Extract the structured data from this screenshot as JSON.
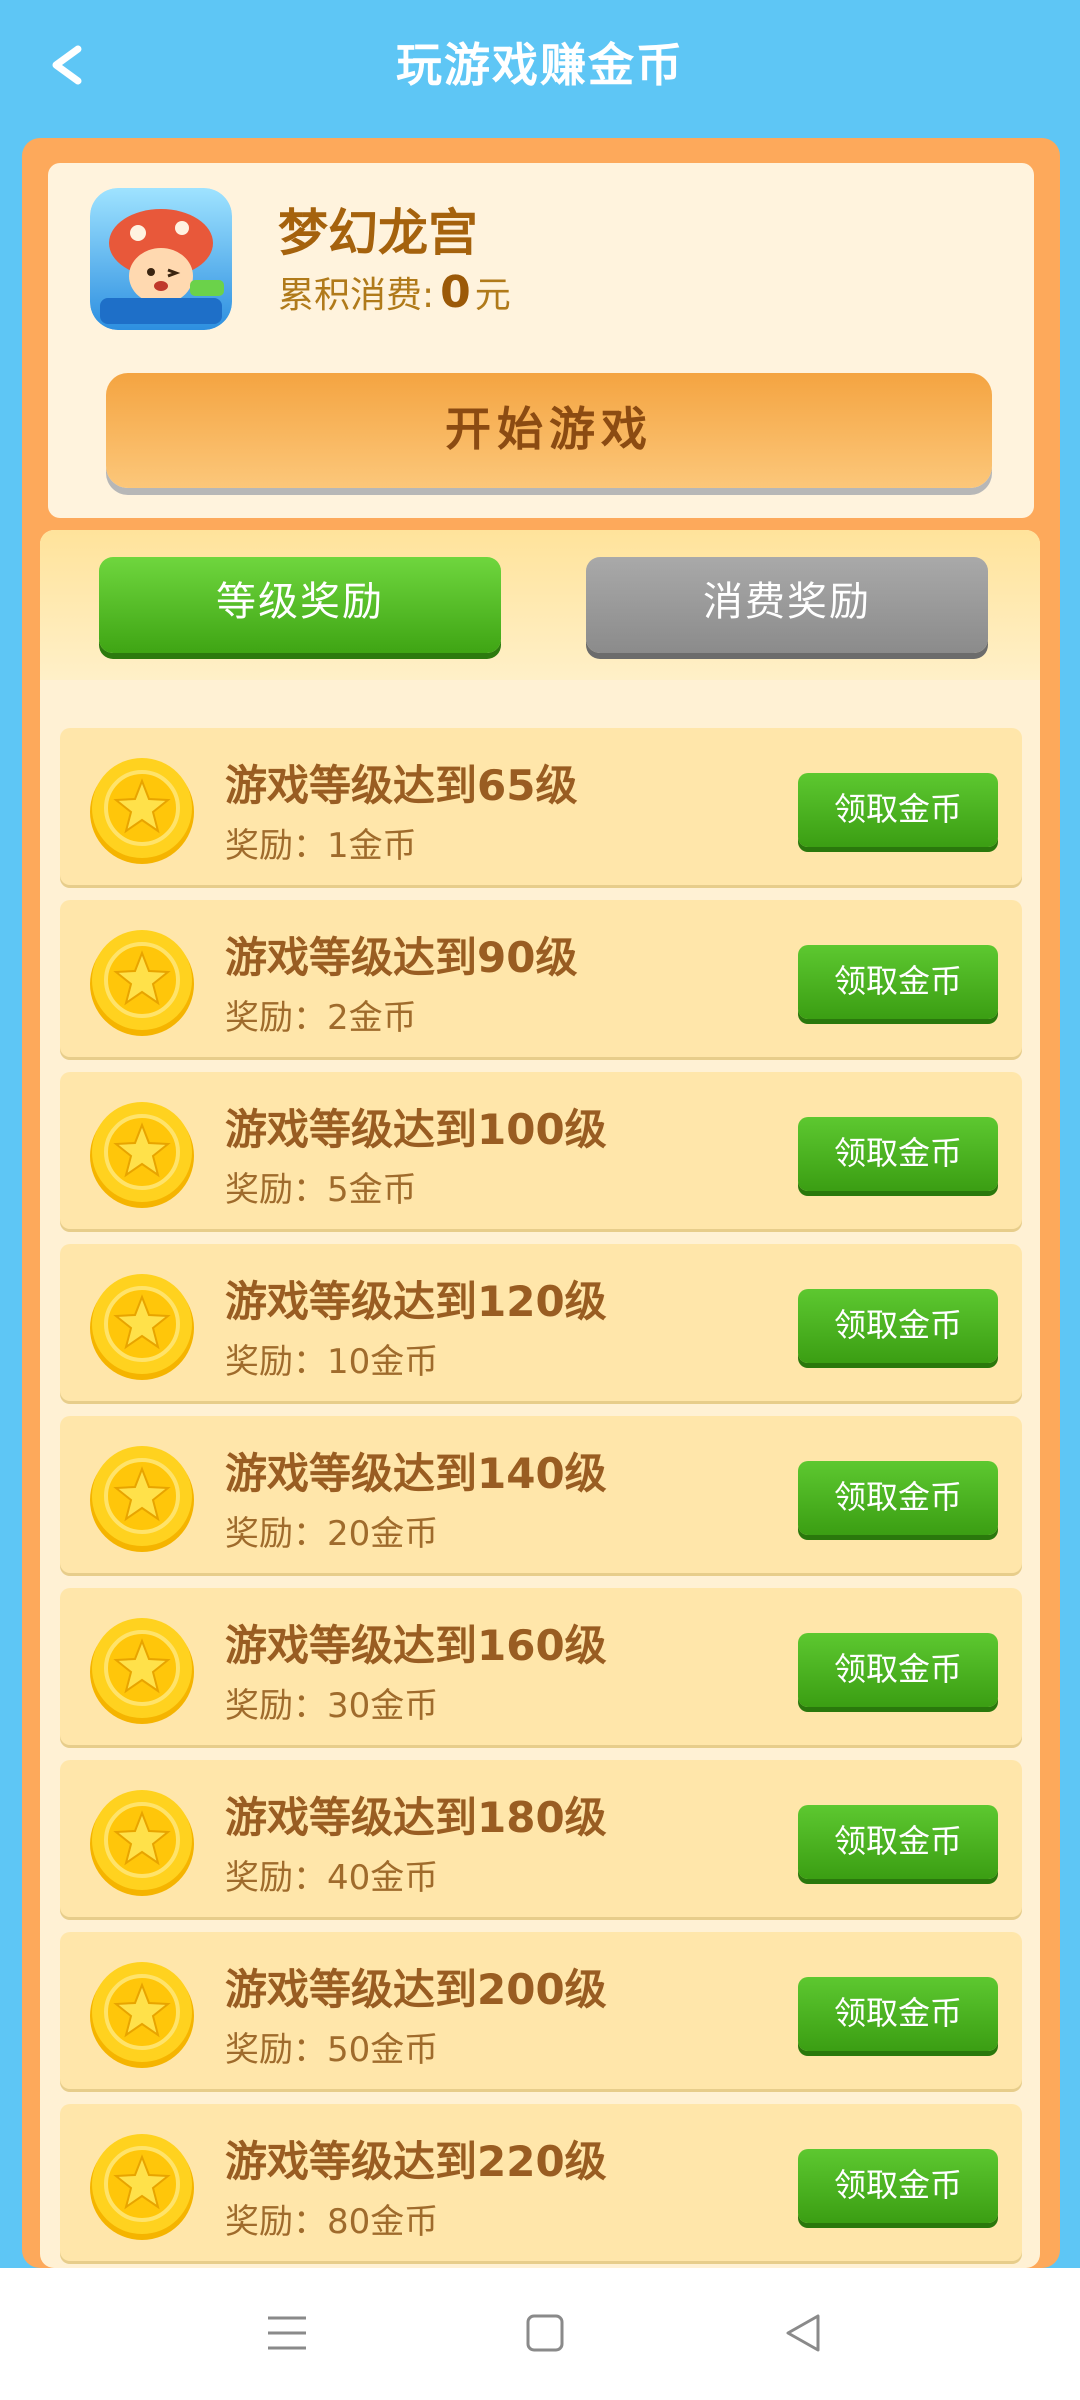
{
  "header": {
    "title": "玩游戏赚金币",
    "back_icon": "chevron-left-icon"
  },
  "game": {
    "name": "梦幻龙宫",
    "spend_label": "累积消费:",
    "spend_amount": "0",
    "spend_unit": "元",
    "start_label": "开始游戏"
  },
  "tabs": [
    {
      "label": "等级奖励",
      "active": true
    },
    {
      "label": "消费奖励",
      "active": false
    }
  ],
  "rewards": [
    {
      "title": "游戏等级达到65级",
      "reward": "奖励：1金币",
      "button": "领取金币"
    },
    {
      "title": "游戏等级达到90级",
      "reward": "奖励：2金币",
      "button": "领取金币"
    },
    {
      "title": "游戏等级达到100级",
      "reward": "奖励：5金币",
      "button": "领取金币"
    },
    {
      "title": "游戏等级达到120级",
      "reward": "奖励：10金币",
      "button": "领取金币"
    },
    {
      "title": "游戏等级达到140级",
      "reward": "奖励：20金币",
      "button": "领取金币"
    },
    {
      "title": "游戏等级达到160级",
      "reward": "奖励：30金币",
      "button": "领取金币"
    },
    {
      "title": "游戏等级达到180级",
      "reward": "奖励：40金币",
      "button": "领取金币"
    },
    {
      "title": "游戏等级达到200级",
      "reward": "奖励：50金币",
      "button": "领取金币"
    },
    {
      "title": "游戏等级达到220级",
      "reward": "奖励：80金币",
      "button": "领取金币"
    }
  ],
  "navbar": {
    "items": [
      "menu-icon",
      "home-square-icon",
      "back-triangle-icon"
    ]
  },
  "colors": {
    "sky": "#5ec6f5",
    "frame": "#fda95b",
    "green": "#3fa514",
    "brown_text": "#995d22"
  }
}
